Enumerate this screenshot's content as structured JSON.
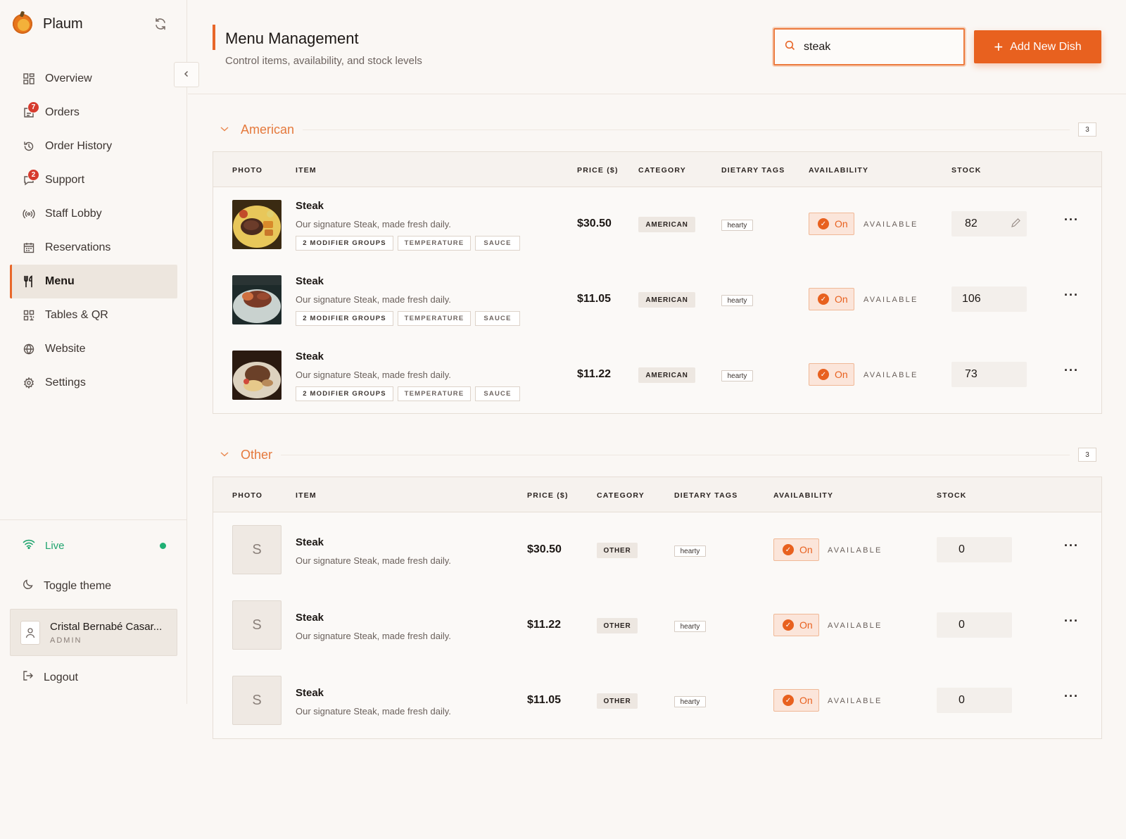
{
  "app": {
    "name": "Plaum"
  },
  "nav": [
    {
      "label": "Overview",
      "icon": "grid-icon"
    },
    {
      "label": "Orders",
      "icon": "orders-icon",
      "badge": "7"
    },
    {
      "label": "Order History",
      "icon": "history-icon"
    },
    {
      "label": "Support",
      "icon": "support-icon",
      "badge": "2"
    },
    {
      "label": "Staff Lobby",
      "icon": "broadcast-icon"
    },
    {
      "label": "Reservations",
      "icon": "calendar-icon"
    },
    {
      "label": "Menu",
      "icon": "utensils-icon",
      "active": true
    },
    {
      "label": "Tables & QR",
      "icon": "qr-icon"
    },
    {
      "label": "Website",
      "icon": "globe-icon"
    },
    {
      "label": "Settings",
      "icon": "gear-icon"
    }
  ],
  "status": {
    "live_label": "Live",
    "toggle_theme": "Toggle theme",
    "logout": "Logout"
  },
  "user": {
    "name": "Cristal Bernabé Casar...",
    "role": "ADMIN"
  },
  "header": {
    "title": "Menu Management",
    "subtitle": "Control items, availability, and stock levels",
    "search_value": "steak",
    "add_button": "Add New Dish"
  },
  "columns": {
    "photo": "PHOTO",
    "item": "ITEM",
    "price": "PRICE ($)",
    "category": "CATEGORY",
    "tags": "DIETARY TAGS",
    "availability": "AVAILABILITY",
    "stock": "STOCK"
  },
  "sections": [
    {
      "name": "American",
      "count": "3",
      "rows": [
        {
          "name": "Steak",
          "desc": "Our signature Steak, made fresh daily.",
          "mods": "2 MODIFIER GROUPS",
          "mod1": "TEMPERATURE",
          "mod2": "SAUCE",
          "price": "$30.50",
          "category": "AMERICAN",
          "tag": "hearty",
          "toggle": "On",
          "avail": "AVAILABLE",
          "stock": "82"
        },
        {
          "name": "Steak",
          "desc": "Our signature Steak, made fresh daily.",
          "mods": "2 MODIFIER GROUPS",
          "mod1": "TEMPERATURE",
          "mod2": "SAUCE",
          "price": "$11.05",
          "category": "AMERICAN",
          "tag": "hearty",
          "toggle": "On",
          "avail": "AVAILABLE",
          "stock": "106"
        },
        {
          "name": "Steak",
          "desc": "Our signature Steak, made fresh daily.",
          "mods": "2 MODIFIER GROUPS",
          "mod1": "TEMPERATURE",
          "mod2": "SAUCE",
          "price": "$11.22",
          "category": "AMERICAN",
          "tag": "hearty",
          "toggle": "On",
          "avail": "AVAILABLE",
          "stock": "73"
        }
      ]
    },
    {
      "name": "Other",
      "count": "3",
      "rows": [
        {
          "initial": "S",
          "name": "Steak",
          "desc": "Our signature Steak, made fresh daily.",
          "price": "$30.50",
          "category": "OTHER",
          "tag": "hearty",
          "toggle": "On",
          "avail": "AVAILABLE",
          "stock": "0"
        },
        {
          "initial": "S",
          "name": "Steak",
          "desc": "Our signature Steak, made fresh daily.",
          "price": "$11.22",
          "category": "OTHER",
          "tag": "hearty",
          "toggle": "On",
          "avail": "AVAILABLE",
          "stock": "0"
        },
        {
          "initial": "S",
          "name": "Steak",
          "desc": "Our signature Steak, made fresh daily.",
          "price": "$11.05",
          "category": "OTHER",
          "tag": "hearty",
          "toggle": "On",
          "avail": "AVAILABLE",
          "stock": "0"
        }
      ]
    }
  ],
  "colors": {
    "accent": "#e8611f",
    "live": "#20a46e",
    "badge": "#d63b2e"
  }
}
